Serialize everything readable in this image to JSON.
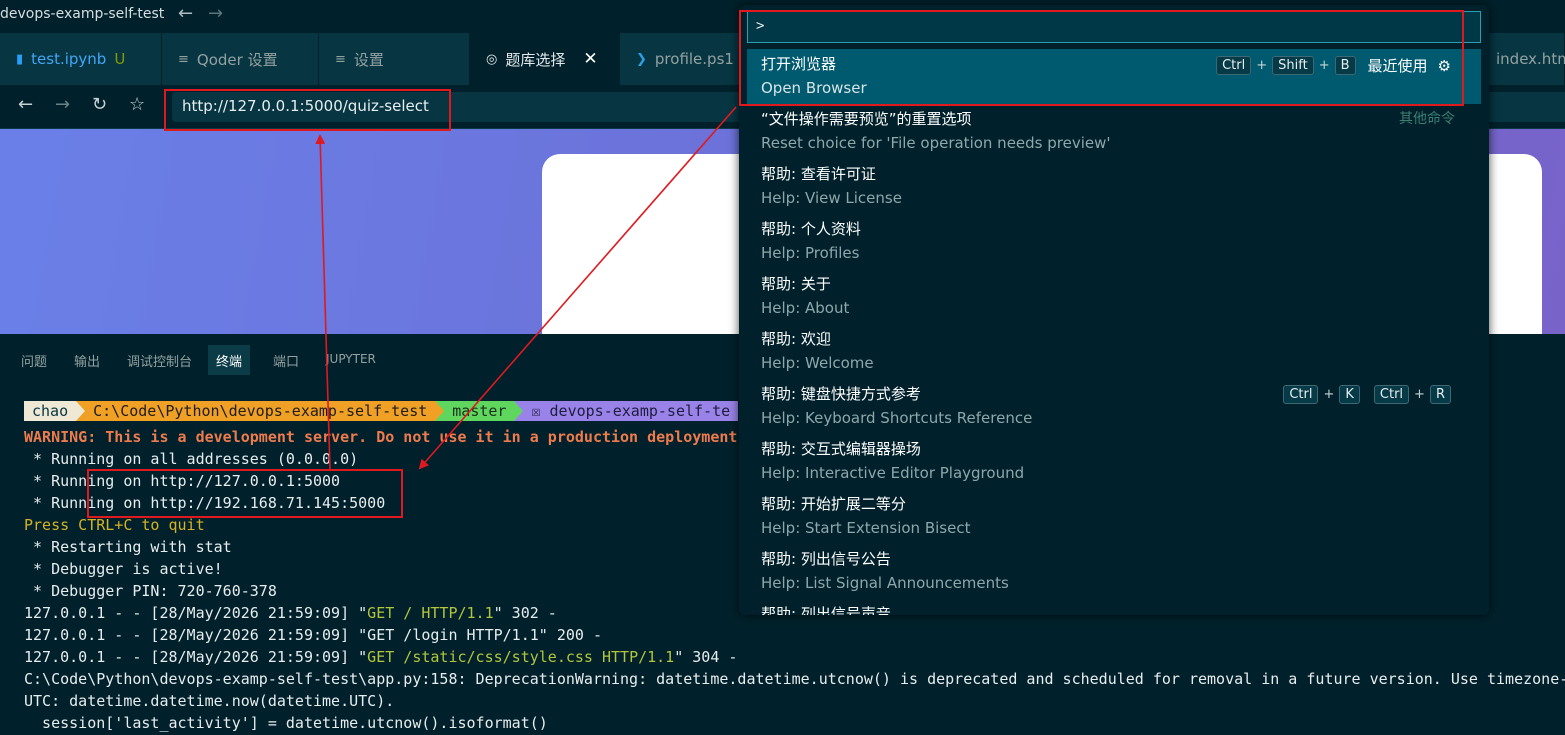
{
  "window": {
    "title": "devops-examp-self-test",
    "back_icon": "arrow-left-icon",
    "forward_icon": "arrow-right-icon"
  },
  "tabs": [
    {
      "label": "test.ipynb",
      "modified": "U",
      "icon": "notebook-icon",
      "active": false
    },
    {
      "label": "Qoder 设置",
      "icon": "settings-sliders-icon",
      "active": false
    },
    {
      "label": "设置",
      "icon": "settings-sliders-icon",
      "active": false
    },
    {
      "label": "题库选择",
      "icon": "globe-icon",
      "active": true
    },
    {
      "label": "profile.ps1",
      "icon": "powershell-icon",
      "active": false
    },
    {
      "label": "index.htm",
      "icon": "file-icon",
      "active": false
    }
  ],
  "browser": {
    "url": "http://127.0.0.1:5000/quiz-select"
  },
  "panel": {
    "tabs": [
      "问题",
      "输出",
      "调试控制台",
      "终端",
      "端口",
      "JUPYTER"
    ],
    "active_tab": "终端"
  },
  "terminal": {
    "prompt": {
      "user": "chao",
      "path": "C:\\Code\\Python\\devops-examp-self-test",
      "branch": "master",
      "env": "☒ devops-examp-self-te"
    },
    "lines": [
      "WARNING: This is a development server. Do not use it in a production deployment.",
      " * Running on all addresses (0.0.0.0)",
      " * Running on http://127.0.0.1:5000",
      " * Running on http://192.168.71.145:5000",
      "Press CTRL+C to quit",
      " * Restarting with stat",
      " * Debugger is active!",
      " * Debugger PIN: 720-760-378",
      "127.0.0.1 - - [28/May/2026 21:59:09] \"",
      "GET / HTTP/1.1",
      "\" 302 -",
      "127.0.0.1 - - [28/May/2026 21:59:09] \"GET /login HTTP/1.1\" 200 -",
      "127.0.0.1 - - [28/May/2026 21:59:09] \"",
      "GET /static/css/style.css HTTP/1.1",
      "\" 304 -",
      "C:\\Code\\Python\\devops-examp-self-test\\app.py:158: DeprecationWarning: datetime.datetime.utcnow() is deprecated and scheduled for removal in a future version. Use timezone-a",
      "UTC: datetime.datetime.now(datetime.UTC).",
      "  session['last_activity'] = datetime.utcnow().isoformat()"
    ]
  },
  "palette": {
    "input_value": ">",
    "items": [
      {
        "zh": "打开浏览器",
        "en": "Open Browser",
        "keys": [
          "Ctrl",
          "Shift",
          "B"
        ],
        "tag": "最近使用"
      },
      {
        "zh": "“文件操作需要预览”的重置选项",
        "en": "Reset choice for 'File operation needs preview'",
        "tag": "其他命令"
      },
      {
        "zh": "帮助: 查看许可证",
        "en": "Help: View License"
      },
      {
        "zh": "帮助: 个人资料",
        "en": "Help: Profiles"
      },
      {
        "zh": "帮助: 关于",
        "en": "Help: About"
      },
      {
        "zh": "帮助: 欢迎",
        "en": "Help: Welcome"
      },
      {
        "zh": "帮助: 键盘快捷方式参考",
        "en": "Help: Keyboard Shortcuts Reference",
        "keys": [
          "Ctrl",
          "K",
          "Ctrl",
          "R"
        ]
      },
      {
        "zh": "帮助: 交互式编辑器操场",
        "en": "Help: Interactive Editor Playground"
      },
      {
        "zh": "帮助: 开始扩展二等分",
        "en": "Help: Start Extension Bisect"
      },
      {
        "zh": "帮助: 列出信号公告",
        "en": "Help: List Signal Announcements"
      },
      {
        "zh": "帮助: 列出信号声音",
        "en": ""
      }
    ]
  },
  "colors": {
    "annotation": "#e0191f",
    "palette_selected": "#005a6f",
    "terminal_bg": "#00212b"
  }
}
